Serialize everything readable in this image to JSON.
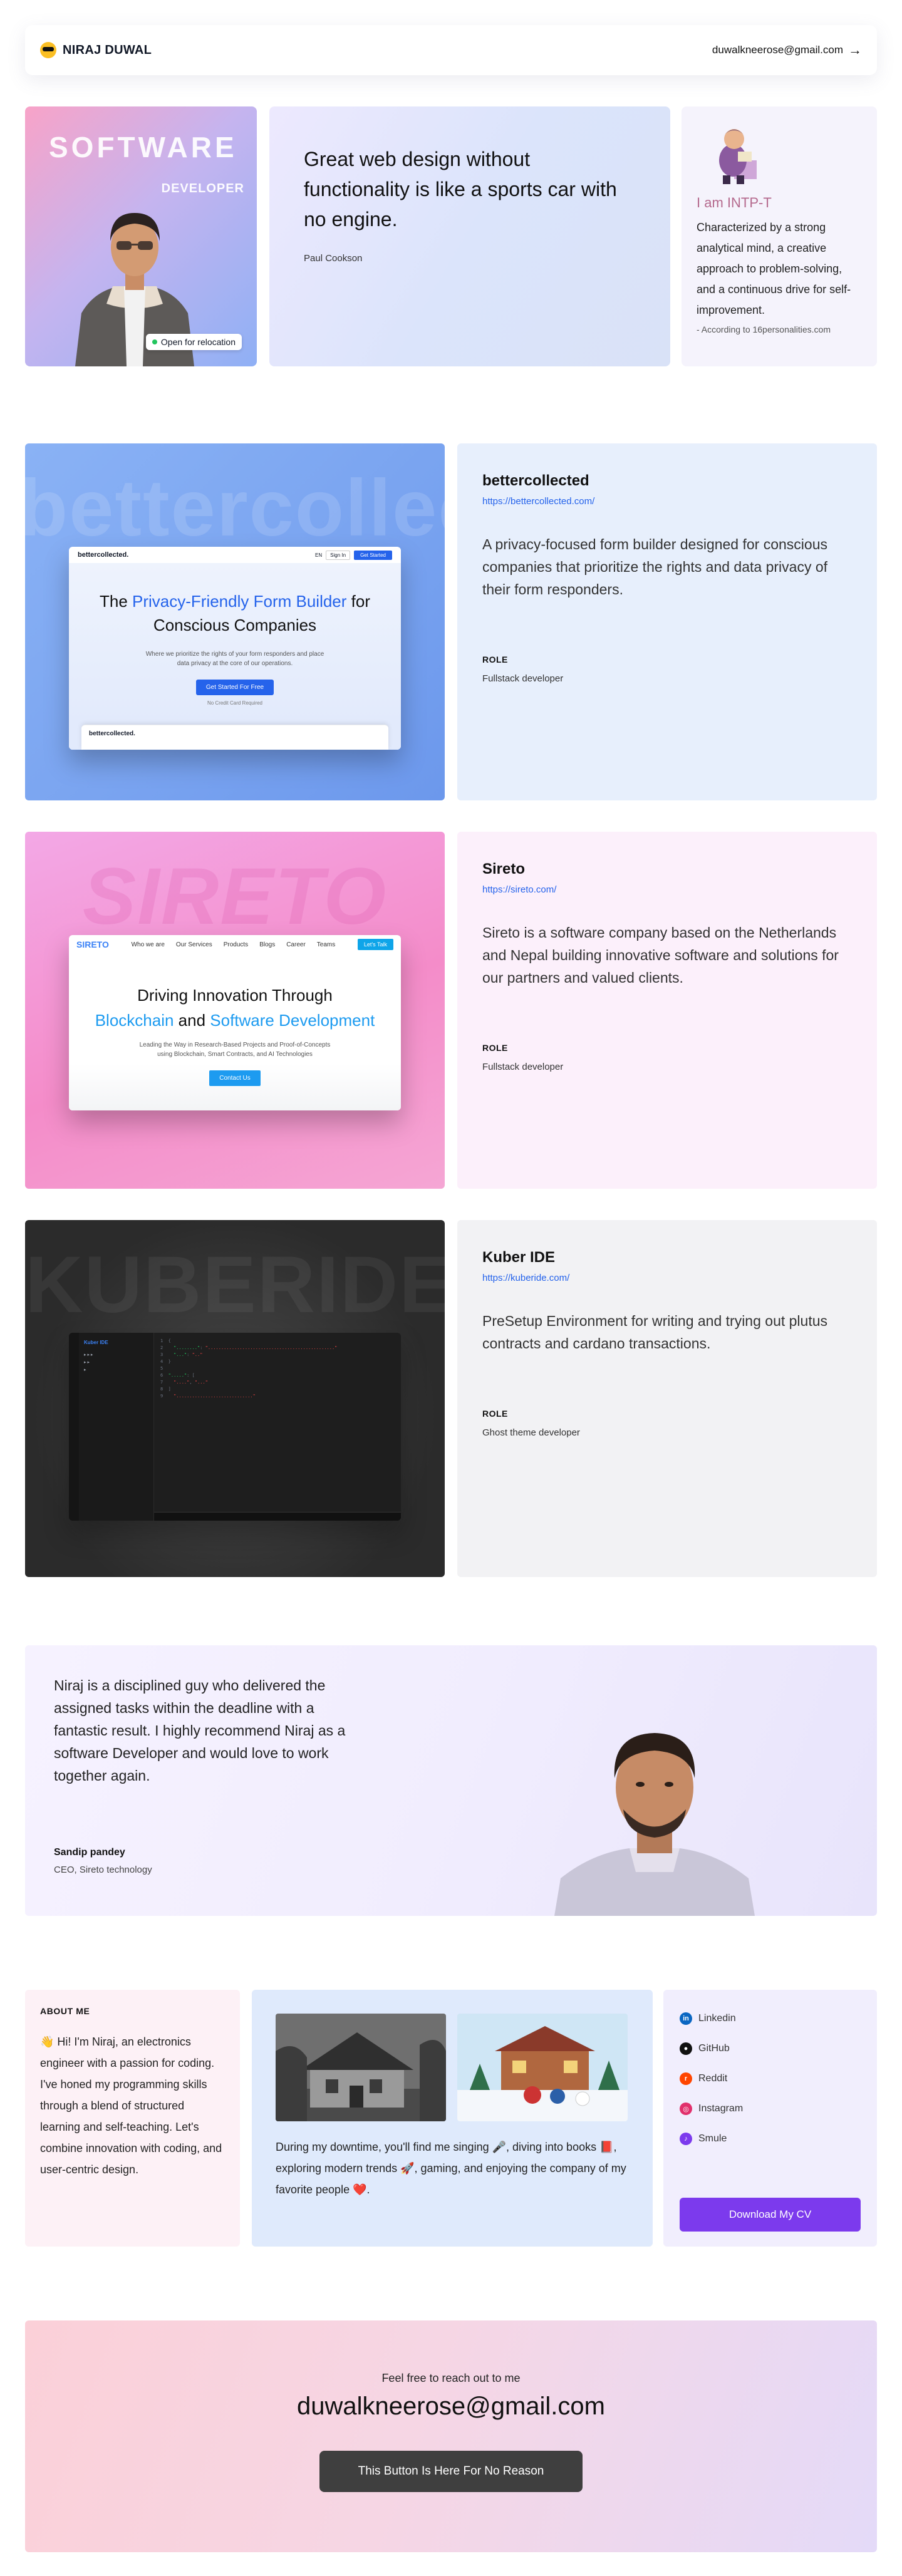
{
  "header": {
    "name": "NIRAJ DUWAL",
    "email": "duwalkneerose@gmail.com",
    "arrow": "→"
  },
  "hero": {
    "photo_title": "SOFTWARE",
    "photo_subtitle": "DEVELOPER",
    "relocation_badge": "Open for relocation",
    "quote": "Great web design without functionality is like a sports car with no engine.",
    "quote_author": "Paul Cookson",
    "personality_title": "I am INTP-T",
    "personality_desc": "Characterized by a strong analytical mind, a creative approach to problem-solving, and a continuous drive for self-improvement.",
    "personality_source": "- According to 16personalities.com"
  },
  "projects": [
    {
      "name": "bettercollected",
      "url": "https://bettercollected.com/",
      "description": "A privacy-focused form builder designed for conscious companies that prioritize the rights and data privacy of their form responders.",
      "role_heading": "ROLE",
      "role": "Fullstack developer",
      "ghost": "bettercollected",
      "mock": {
        "logo": "bettercollected.",
        "nav_login": "Sign In",
        "nav_signup": "Get Started",
        "nav_lang": "EN",
        "headline_pre": "The ",
        "headline_hl": "Privacy-Friendly Form Builder",
        "headline_post": " for Conscious Companies",
        "para": "Where we prioritize the rights of your form responders and place data privacy at the core of our operations.",
        "cta": "Get Started For Free",
        "tiny": "No Credit Card Required",
        "sub_logo": "bettercollected."
      }
    },
    {
      "name": "Sireto",
      "url": "https://sireto.com/",
      "description": "Sireto is a software company based on the Netherlands and Nepal building innovative software and solutions for our partners and valued clients.",
      "role_heading": "ROLE",
      "role": "Fullstack developer",
      "ghost": "SIRETO",
      "mock": {
        "logo": "SIRETO",
        "nav": [
          "Who we are",
          "Our Services",
          "Products",
          "Blogs",
          "Career",
          "Teams"
        ],
        "cta_top": "Let's Talk",
        "headline_pre": "Driving Innovation Through",
        "headline_hl1": "Blockchain",
        "headline_mid": " and ",
        "headline_hl2": "Software Development",
        "para": "Leading the Way in Research-Based Projects and Proof-of-Concepts using Blockchain, Smart Contracts, and AI Technologies",
        "cta": "Contact Us"
      }
    },
    {
      "name": "Kuber IDE",
      "url": "https://kuberide.com/",
      "description": "PreSetup Environment for writing and trying out plutus contracts and cardano transactions.",
      "role_heading": "ROLE",
      "role": "Ghost theme developer",
      "ghost": "KUBERIDE",
      "mock": {
        "logo": "Kuber IDE"
      }
    }
  ],
  "testimonial": {
    "quote": "Niraj is a disciplined guy who delivered the assigned tasks within the deadline with a fantastic result. I highly recommend Niraj as a software Developer and would love to work together again.",
    "author": "Sandip pandey",
    "position": "CEO, Sireto technology"
  },
  "about": {
    "heading": "ABOUT ME",
    "text": "👋 Hi! I'm Niraj, an electronics engineer with a passion for coding. I've honed my programming skills through a blend of structured learning and self-teaching. Let's combine innovation with coding, and user-centric design."
  },
  "hobbies": {
    "text": "During my downtime, you'll find me singing 🎤, diving into books 📕, exploring modern trends 🚀, gaming, and enjoying the company of my favorite people ❤️."
  },
  "social": {
    "items": [
      {
        "label": "Linkedin",
        "icon": "linkedin-icon",
        "color": "#0a66c2",
        "glyph": "in"
      },
      {
        "label": "GitHub",
        "icon": "github-icon",
        "color": "#111111",
        "glyph": "●"
      },
      {
        "label": "Reddit",
        "icon": "reddit-icon",
        "color": "#ff4500",
        "glyph": "r"
      },
      {
        "label": "Instagram",
        "icon": "instagram-icon",
        "color": "#e1306c",
        "glyph": "◎"
      },
      {
        "label": "Smule",
        "icon": "smule-icon",
        "color": "#7c3aed",
        "glyph": "♪"
      }
    ],
    "cv_button": "Download My CV"
  },
  "contact": {
    "lead": "Feel free to reach out to me",
    "email": "duwalkneerose@gmail.com",
    "button": "This Button Is Here For No Reason"
  }
}
